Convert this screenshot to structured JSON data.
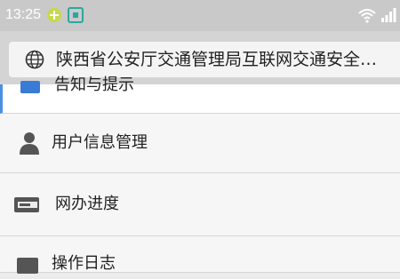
{
  "status_bar": {
    "time": "13:25",
    "icons": [
      "battery-saver-icon",
      "screenshot-icon",
      "wifi-icon",
      "signal-icon"
    ]
  },
  "browser": {
    "url_text": "陕西省公安厅交通管理局互联网交通安全…",
    "icon": "globe-icon"
  },
  "menu": {
    "items": [
      {
        "label": "告知与提示",
        "icon": "notice-icon"
      },
      {
        "label": "用户信息管理",
        "icon": "person-icon"
      },
      {
        "label": "网办进度",
        "icon": "progress-card-icon"
      },
      {
        "label": "操作日志",
        "icon": "log-icon"
      }
    ]
  },
  "colors": {
    "accent": "#4a90e2",
    "status_bar": "#c9c9c9",
    "background": "#ececec"
  }
}
